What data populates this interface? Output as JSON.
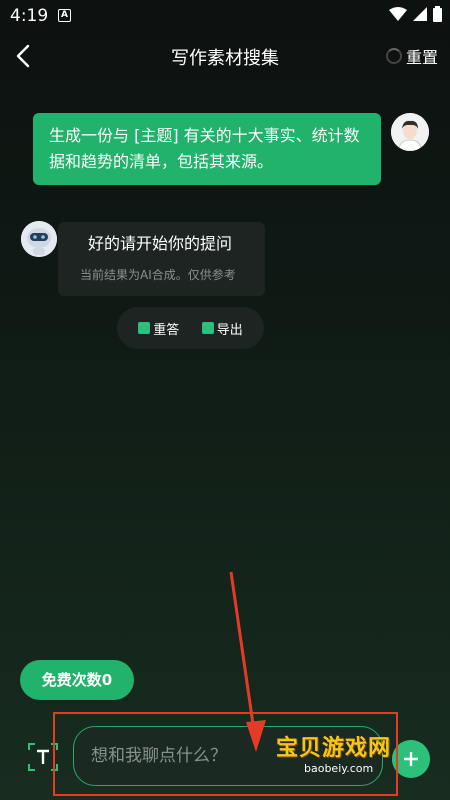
{
  "status": {
    "time": "4:19",
    "notif_letter": "A"
  },
  "header": {
    "back_icon": "chevron-left-icon",
    "title": "写作素材搜集",
    "reset_label": "重置"
  },
  "user_message": {
    "text": "生成一份与 [主题] 有关的十大事实、统计数据和趋势的清单，包括其来源。"
  },
  "bot_message": {
    "text": "好的请开始你的提问",
    "note": "当前结果为AI合成。仅供参考"
  },
  "actions": {
    "regenerate_label": "重答",
    "export_label": "导出"
  },
  "free_button": {
    "label": "免费次数0"
  },
  "input": {
    "placeholder": "想和我聊点什么？",
    "value": ""
  },
  "watermark": {
    "text": "宝贝游戏网",
    "sub": "baobeiy.com"
  },
  "colors": {
    "accent": "#21b26b",
    "annotation": "#e53b26"
  }
}
